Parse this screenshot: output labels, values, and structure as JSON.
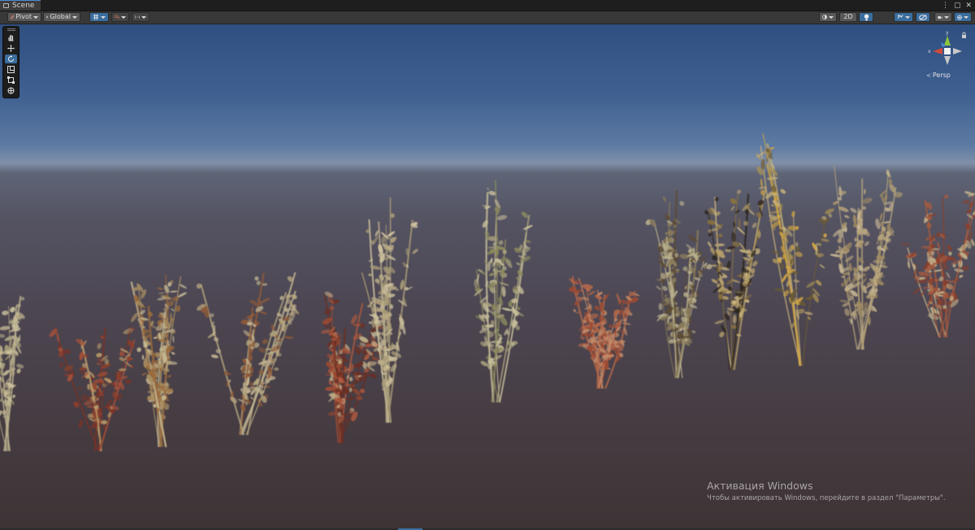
{
  "window": {
    "tab_label": "Scene"
  },
  "toolbar": {
    "pivot_label": "Pivot",
    "global_label": "Global",
    "mode_2d_label": "2D"
  },
  "scene": {
    "projection_label": "Persp",
    "gizmo_axes": {
      "x": "x",
      "y": "y"
    }
  },
  "overlay": {
    "activation_title": "Активация Windows",
    "activation_text": "Чтобы активировать Windows, перейдите в раздел \"Параметры\"."
  },
  "colors": {
    "accent": "#3a6d9e",
    "x_axis": "#d24a3a",
    "y_axis": "#8cc63e",
    "z_axis": "#4a8ad6"
  }
}
